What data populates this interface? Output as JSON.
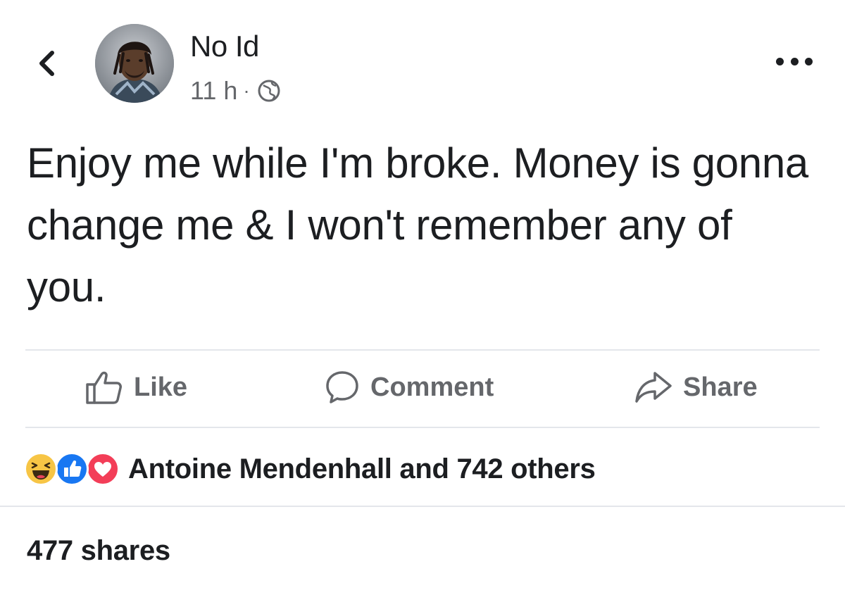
{
  "post": {
    "author": "No Id",
    "timestamp": "11 h",
    "separator": "·",
    "privacy_icon": "globe-icon",
    "text": "Enjoy me while I'm broke. Money is gonna change me & I won't remember any of you."
  },
  "nav": {
    "back_icon": "chevron-left-icon",
    "more_icon": "more-options-icon"
  },
  "actions": {
    "like_label": "Like",
    "comment_label": "Comment",
    "share_label": "Share"
  },
  "reactions": {
    "icons": [
      "haha-reaction-icon",
      "like-reaction-icon",
      "love-reaction-icon"
    ],
    "summary": "Antoine Mendenhall and 742 others"
  },
  "shares": {
    "label": "477 shares"
  },
  "colors": {
    "text": "#1c1e21",
    "secondary": "#65676b",
    "divider": "#e4e6eb",
    "like_blue": "#1877f2",
    "love_red": "#f33e58",
    "haha_yellow": "#f7c545"
  }
}
